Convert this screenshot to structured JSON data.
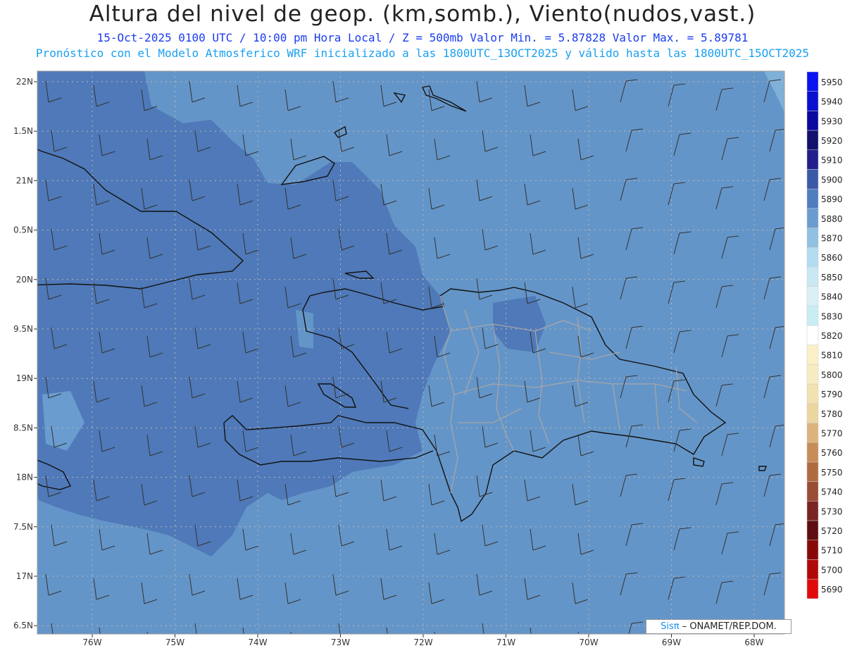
{
  "header": {
    "title": "Altura del nivel de geop. (km,somb.), Viento(nudos,vast.)",
    "line2": "15-Oct-2025  0100 UTC / 10:00 pm Hora Local / Z = 500mb   Valor Min. = 5.87828  Valor Max. = 5.89781",
    "line3": "Pronóstico con el Modelo Atmosferico WRF inicializado a las 1800UTC_13OCT2025 y válido hasta las  1800UTC_15OCT2025"
  },
  "map": {
    "lat_labels": [
      "22N",
      "1.5N",
      "21N",
      "0.5N",
      "20N",
      "9.5N",
      "19N",
      "8.5N",
      "18N",
      "7.5N",
      "17N",
      "6.5N"
    ],
    "lon_labels": [
      "76W",
      "75W",
      "74W",
      "73W",
      "72W",
      "71W",
      "70W",
      "69W",
      "68W"
    ],
    "colors": {
      "ocean_main": "#6495c8",
      "dark_zone": "#4f79b8",
      "light_zone": "#7fb0d8",
      "coast": "#111111",
      "provinces": "#a6a6a6"
    }
  },
  "colorbar": {
    "labels": [
      "5950",
      "5940",
      "5930",
      "5920",
      "5910",
      "5900",
      "5890",
      "5880",
      "5870",
      "5860",
      "5850",
      "5840",
      "5830",
      "5820",
      "5810",
      "5800",
      "5790",
      "5780",
      "5770",
      "5760",
      "5750",
      "5740",
      "5730",
      "5720",
      "5710",
      "5700",
      "5690"
    ],
    "colors": [
      "#0a14f0",
      "#0a0fd0",
      "#0a0aa0",
      "#14106e",
      "#231e8c",
      "#3a5aa8",
      "#4f7dbe",
      "#6a9cd0",
      "#90c0e2",
      "#b4dcf0",
      "#cae8f4",
      "#d8f0f6",
      "#c8eef4",
      "#ffffff",
      "#fbf0c8",
      "#f7ecc0",
      "#f2e2b0",
      "#ecd6a0",
      "#dcb47c",
      "#c88c58",
      "#b06c40",
      "#9a4c34",
      "#7a2424",
      "#5e0e10",
      "#880808",
      "#b00808",
      "#e00a0a"
    ]
  },
  "credit": {
    "sis": "Sisπ",
    "org": "– ONAMET/REP.DOM."
  }
}
